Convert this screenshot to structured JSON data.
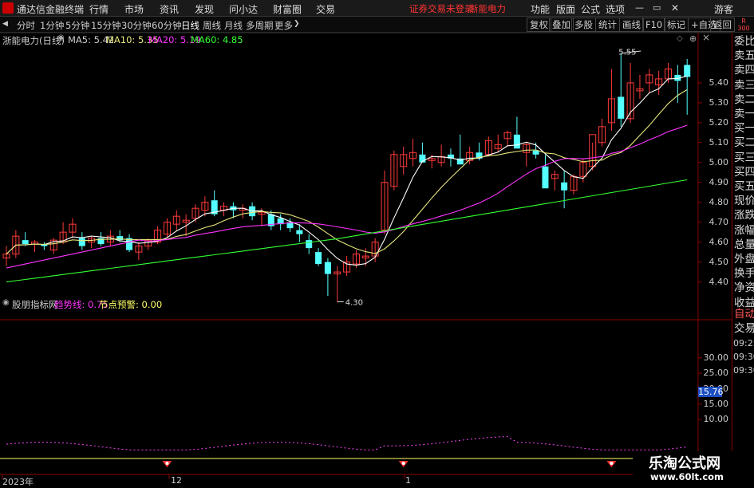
{
  "titlebar": {
    "app_name": "通达信金融终端",
    "menus": [
      "行情",
      "市场",
      "资讯",
      "发现",
      "问小达",
      "财富圈",
      "交易"
    ],
    "status": "证券交易未登录",
    "stock_name": "浙能电力",
    "right_menus": [
      "功能",
      "版面",
      "公式",
      "选项"
    ],
    "user": "游客"
  },
  "toolbar": {
    "periods": [
      "分时",
      "1分钟",
      "5分钟",
      "15分钟",
      "30分钟",
      "60分钟",
      "日线",
      "周线",
      "月线",
      "多周期",
      "更多"
    ],
    "active_period": "日线",
    "right_buttons": [
      "复权",
      "叠加",
      "多股",
      "统计",
      "画线",
      "F10",
      "标记",
      "+自选",
      "返回"
    ],
    "corner": "R\n300"
  },
  "price_panel": {
    "title": "浙能电力(日线)",
    "ma": [
      {
        "label": "MA5: 5.42",
        "color": "#ffffff"
      },
      {
        "label": "MA10: 5.35",
        "color": "#e6e67a"
      },
      {
        "label": "MA20: 5.19",
        "color": "#ff33ff"
      },
      {
        "label": "MA60: 4.85",
        "color": "#33ff33"
      }
    ],
    "axis": [
      "5.40",
      "5.30",
      "5.20",
      "5.10",
      "5.00",
      "4.90",
      "4.80",
      "4.70",
      "4.60",
      "4.50",
      "4.40"
    ],
    "high_label": "5.55",
    "low_label": "4.30"
  },
  "indicator_panel": {
    "title": "股朋指标网",
    "lines": [
      {
        "label": "趋势线: 0.75",
        "color": "#ff33ff"
      },
      {
        "label": "节点预警: 0.00",
        "color": "#ffff66"
      }
    ],
    "axis": [
      "30.00",
      "25.00",
      "20.00",
      "15.00",
      "10.00"
    ],
    "current_value": "15.76"
  },
  "bottom_axis": [
    "2023年",
    "12",
    "1"
  ],
  "right_panel": {
    "items": [
      "委比",
      "卖五",
      "卖四",
      "卖三",
      "卖二",
      "卖一",
      "买一",
      "买二",
      "买三",
      "买四",
      "买五",
      "现价",
      "涨跌",
      "涨幅",
      "总量",
      "外盘",
      "换手",
      "净资",
      "收益"
    ],
    "auto_label": "自动",
    "trade_label": "交易",
    "times": [
      "09:25",
      "09:30",
      "09:30"
    ]
  },
  "watermark": {
    "text": "乐淘公式网",
    "url": "www.60lt.com"
  },
  "chart_data": {
    "type": "candlestick",
    "ylim": [
      4.25,
      5.62
    ],
    "candles": [
      [
        4.52,
        4.58,
        4.48,
        4.54
      ],
      [
        4.54,
        4.66,
        4.52,
        4.63
      ],
      [
        4.61,
        4.65,
        4.58,
        4.59
      ],
      [
        4.59,
        4.61,
        4.55,
        4.6
      ],
      [
        4.59,
        4.6,
        4.56,
        4.58
      ],
      [
        4.56,
        4.62,
        4.54,
        4.61
      ],
      [
        4.6,
        4.7,
        4.59,
        4.65
      ],
      [
        4.65,
        4.72,
        4.62,
        4.69
      ],
      [
        4.62,
        4.65,
        4.56,
        4.58
      ],
      [
        4.6,
        4.63,
        4.57,
        4.62
      ],
      [
        4.62,
        4.65,
        4.58,
        4.59
      ],
      [
        4.6,
        4.66,
        4.58,
        4.63
      ],
      [
        4.63,
        4.66,
        4.6,
        4.61
      ],
      [
        4.62,
        4.64,
        4.55,
        4.56
      ],
      [
        4.55,
        4.6,
        4.51,
        4.58
      ],
      [
        4.58,
        4.62,
        4.56,
        4.61
      ],
      [
        4.6,
        4.68,
        4.59,
        4.66
      ],
      [
        4.64,
        4.72,
        4.62,
        4.7
      ],
      [
        4.69,
        4.76,
        4.66,
        4.73
      ],
      [
        4.7,
        4.74,
        4.63,
        4.71
      ],
      [
        4.72,
        4.79,
        4.7,
        4.77
      ],
      [
        4.76,
        4.83,
        4.73,
        4.8
      ],
      [
        4.81,
        4.86,
        4.73,
        4.74
      ],
      [
        4.76,
        4.8,
        4.73,
        4.78
      ],
      [
        4.78,
        4.8,
        4.72,
        4.76
      ],
      [
        4.76,
        4.79,
        4.72,
        4.77
      ],
      [
        4.78,
        4.8,
        4.71,
        4.73
      ],
      [
        4.74,
        4.77,
        4.68,
        4.75
      ],
      [
        4.74,
        4.76,
        4.66,
        4.68
      ],
      [
        4.72,
        4.74,
        4.66,
        4.69
      ],
      [
        4.7,
        4.72,
        4.65,
        4.67
      ],
      [
        4.66,
        4.69,
        4.6,
        4.64
      ],
      [
        4.61,
        4.64,
        4.54,
        4.57
      ],
      [
        4.55,
        4.57,
        4.48,
        4.49
      ],
      [
        4.5,
        4.52,
        4.33,
        4.44
      ],
      [
        4.44,
        4.48,
        4.3,
        4.45
      ],
      [
        4.45,
        4.53,
        4.43,
        4.5
      ],
      [
        4.49,
        4.56,
        4.47,
        4.54
      ],
      [
        4.52,
        4.57,
        4.48,
        4.53
      ],
      [
        4.53,
        4.62,
        4.5,
        4.6
      ],
      [
        4.66,
        4.96,
        4.64,
        4.9
      ],
      [
        4.88,
        5.06,
        4.86,
        5.04
      ],
      [
        4.98,
        5.08,
        4.94,
        5.04
      ],
      [
        5.02,
        5.12,
        4.98,
        5.05
      ],
      [
        5.04,
        5.1,
        5.0,
        5.0
      ],
      [
        5.01,
        5.04,
        4.97,
        5.02
      ],
      [
        5.0,
        5.09,
        4.98,
        5.03
      ],
      [
        5.04,
        5.07,
        4.98,
        5.02
      ],
      [
        5.02,
        5.14,
        5.0,
        4.99
      ],
      [
        5.01,
        5.08,
        4.99,
        5.05
      ],
      [
        5.05,
        5.1,
        5.01,
        5.02
      ],
      [
        5.04,
        5.13,
        5.03,
        5.11
      ],
      [
        5.07,
        5.14,
        5.05,
        5.09
      ],
      [
        5.12,
        5.16,
        5.08,
        5.15
      ],
      [
        5.14,
        5.23,
        5.11,
        5.07
      ],
      [
        5.05,
        5.1,
        4.98,
        5.09
      ],
      [
        5.06,
        5.1,
        5.02,
        5.04
      ],
      [
        4.98,
        5.04,
        4.88,
        4.87
      ],
      [
        4.92,
        4.96,
        4.86,
        4.94
      ],
      [
        4.9,
        4.96,
        4.77,
        4.86
      ],
      [
        4.86,
        4.94,
        4.84,
        4.93
      ],
      [
        4.93,
        5.02,
        4.9,
        5.0
      ],
      [
        4.98,
        5.1,
        4.96,
        5.14
      ],
      [
        5.1,
        5.22,
        5.08,
        5.18
      ],
      [
        5.2,
        5.47,
        5.16,
        5.32
      ],
      [
        5.33,
        5.55,
        5.18,
        5.22
      ],
      [
        5.22,
        5.5,
        5.2,
        5.4
      ],
      [
        5.36,
        5.44,
        5.32,
        5.37
      ],
      [
        5.4,
        5.47,
        5.35,
        5.44
      ],
      [
        5.39,
        5.46,
        5.34,
        5.42
      ],
      [
        5.42,
        5.5,
        5.4,
        5.47
      ],
      [
        5.44,
        5.49,
        5.3,
        5.41
      ],
      [
        5.49,
        5.52,
        5.24,
        5.43
      ]
    ],
    "ma_colors": {
      "ma5": "#ffffff",
      "ma10": "#e6e67a",
      "ma20": "#ff33ff",
      "ma60": "#33ff33"
    },
    "indicator_range": [
      0,
      40
    ],
    "indicator_current": 15.76
  }
}
